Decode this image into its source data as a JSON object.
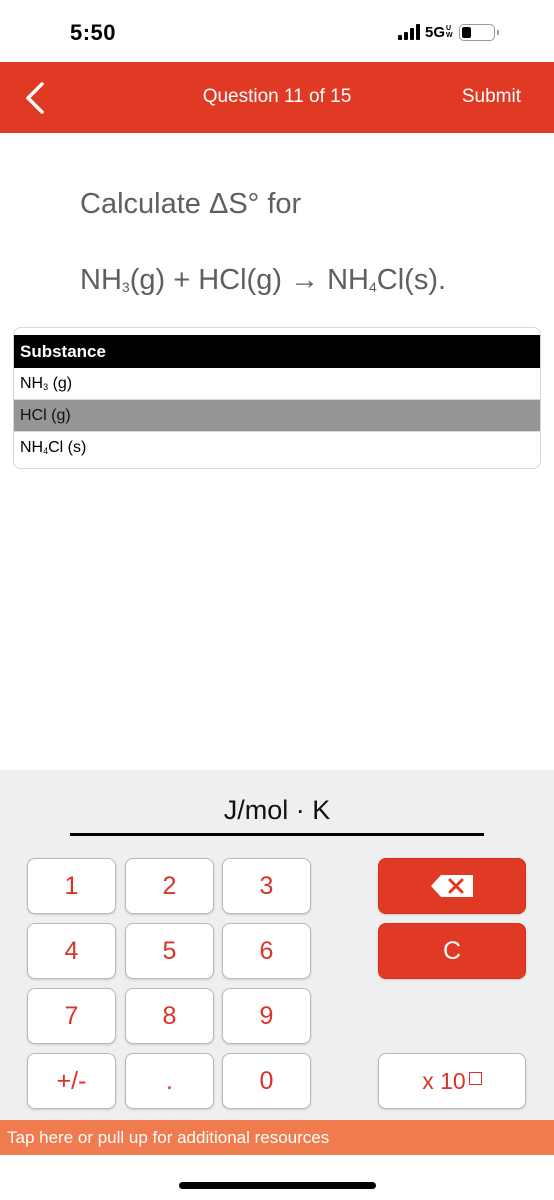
{
  "status_bar": {
    "time": "5:50",
    "network": "5G",
    "network_badge": [
      "U",
      "W"
    ],
    "battery_level_fraction": 0.3
  },
  "header": {
    "back_icon": "chevron-left-icon",
    "title": "Question 11 of 15",
    "submit_label": "Submit"
  },
  "question": {
    "prompt": "Calculate ΔS° for",
    "equation": {
      "reactant1": "NH",
      "reactant1_sub": "3",
      "reactant1_state": "(g)",
      "plus": "+",
      "reactant2": "HCl(g)",
      "arrow": "→",
      "product": "NH",
      "product_sub": "4",
      "product_rest": "Cl(s)."
    }
  },
  "table": {
    "header": "Substance",
    "rows": [
      {
        "formula": "NH",
        "sub": "3",
        "rest": " (g)",
        "highlighted": false
      },
      {
        "formula": "HCl",
        "sub": "",
        "rest": " (g)",
        "highlighted": true
      },
      {
        "formula": "NH",
        "sub": "4",
        "rest": "Cl (s)",
        "highlighted": false
      }
    ]
  },
  "answer": {
    "value": "",
    "unit": "J/mol · K"
  },
  "keypad": {
    "keys": [
      "1",
      "2",
      "3",
      "4",
      "5",
      "6",
      "7",
      "8",
      "9",
      "+/-",
      ".",
      "0"
    ],
    "backspace_icon": "backspace-icon",
    "clear_label": "C",
    "exponent_label": "x 10"
  },
  "resources_bar": {
    "label": "Tap here or pull up for additional resources"
  },
  "colors": {
    "brand_red": "#e03a25",
    "resources_orange": "#ef7b4f",
    "key_text": "#d9332a",
    "highlight_row": "#959595"
  }
}
